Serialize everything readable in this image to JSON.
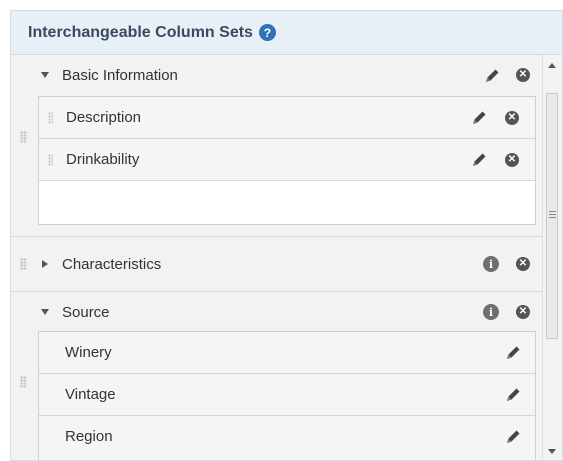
{
  "panel": {
    "title": "Interchangeable Column Sets",
    "help_icon": "question-circle-icon"
  },
  "groups": [
    {
      "label": "Basic Information",
      "expanded": true,
      "items": [
        {
          "label": "Description"
        },
        {
          "label": "Drinkability"
        }
      ]
    },
    {
      "label": "Characteristics",
      "expanded": false,
      "items": []
    },
    {
      "label": "Source",
      "expanded": true,
      "items": [
        {
          "label": "Winery"
        },
        {
          "label": "Vintage"
        },
        {
          "label": "Region"
        }
      ]
    }
  ],
  "icons": {
    "edit": "pencil-icon",
    "remove": "close-circle-icon",
    "info": "info-circle-icon",
    "help_symbol": "?",
    "remove_symbol": "✕",
    "info_symbol": "i"
  },
  "colors": {
    "header_bg": "#e8f0f7",
    "accent": "#2f72b5"
  }
}
